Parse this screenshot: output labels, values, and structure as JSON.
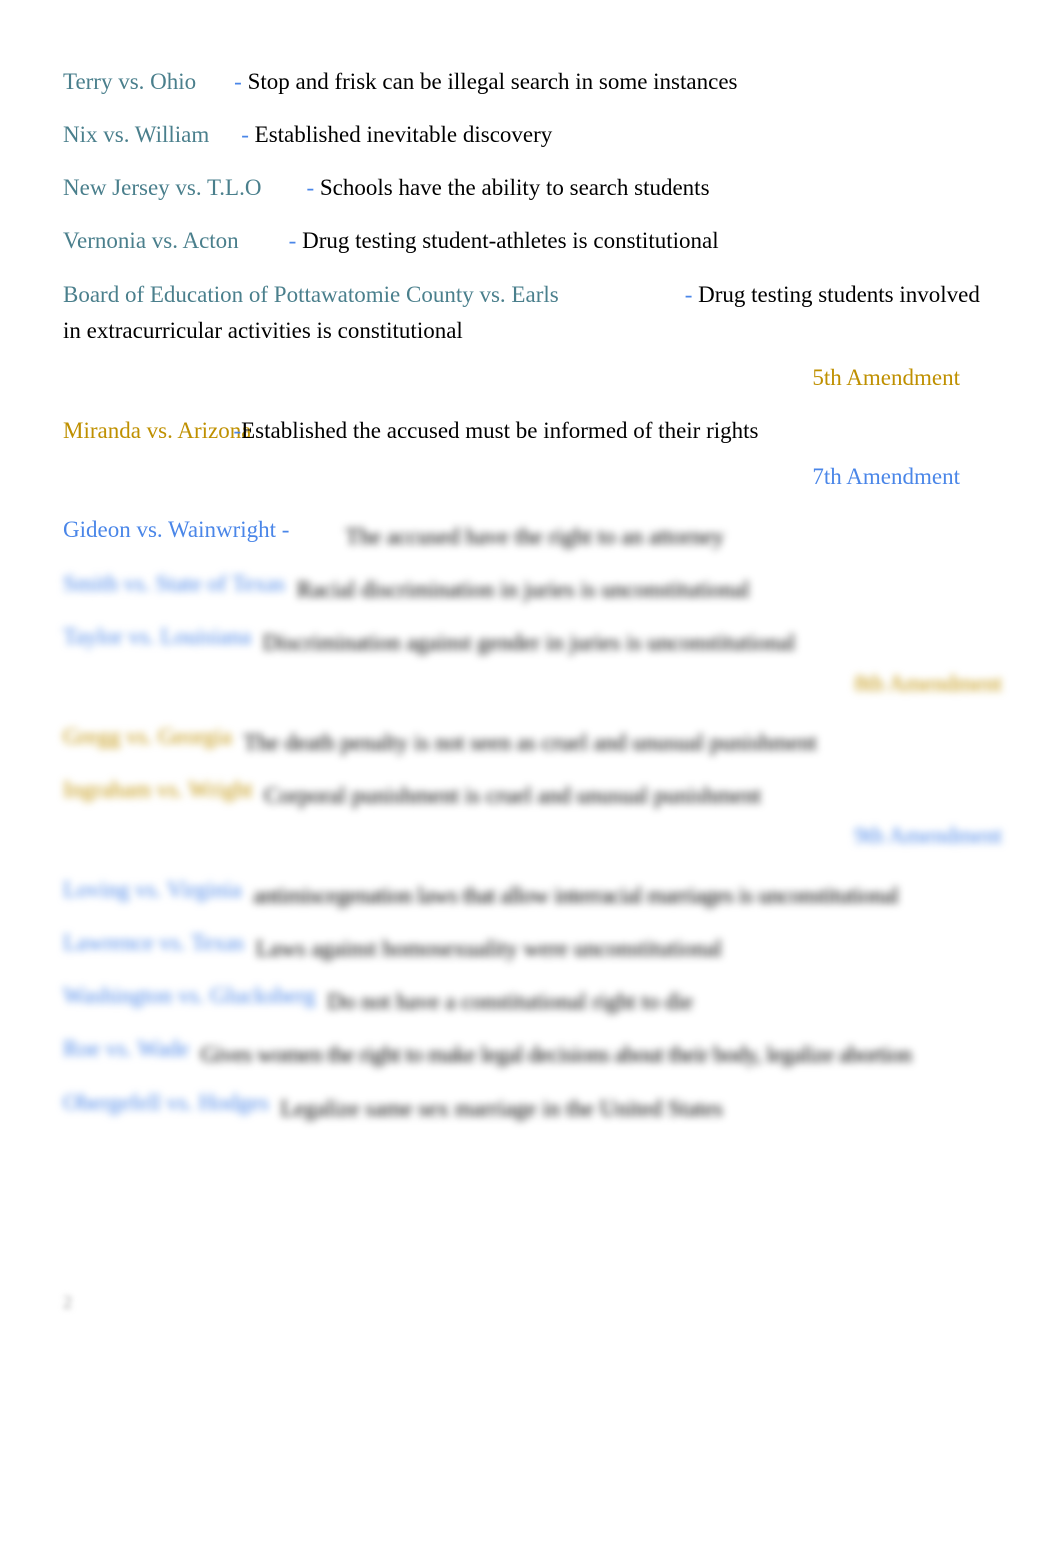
{
  "colors": {
    "fourth_case": "#4a7f8c",
    "seventh_case": "#4a86e8",
    "fifth_case": "#bf9000",
    "dash": "#4a86e8"
  },
  "cases_top": [
    {
      "name": "Terry vs. Ohio",
      "desc": "Stop and frisk can be illegal search in some instances"
    },
    {
      "name": "Nix vs. William",
      "desc": "Established inevitable discovery"
    },
    {
      "name": "New Jersey vs. T.L.O",
      "desc": "Schools have the ability to search students"
    },
    {
      "name": "Vernonia vs. Acton",
      "desc": "Drug testing student-athletes is constitutional"
    },
    {
      "name": "Board of Education of Pottawatomie County vs. Earls",
      "desc": "Drug testing students involved",
      "desc_cont": "in extracurricular activities is constitutional"
    }
  ],
  "dash": "-",
  "fifth": {
    "heading": "5th Amendment",
    "case": {
      "name": "Miranda vs. Arizona",
      "desc": "Established the accused must be informed of their rights"
    }
  },
  "seventh": {
    "heading": "7th Amendment",
    "cases": [
      {
        "name": "Gideon vs. Wainwright -",
        "desc": "The accused have the right to an attorney"
      },
      {
        "name": "Smith vs. State of Texas",
        "desc": "Racial discrimination in juries is unconstitutional"
      },
      {
        "name": "Taylor vs. Louisiana",
        "desc": "Discrimination against gender in juries is unconstitutional"
      }
    ]
  },
  "eighth": {
    "heading": "8th Amendment",
    "cases": [
      {
        "name": "Gregg vs. Georgia",
        "desc": "The death penalty is not seen as cruel and unusual punishment"
      },
      {
        "name": "Ingraham vs. Wright",
        "desc": "Corporal punishment is cruel and unusual punishment"
      }
    ]
  },
  "ninth": {
    "heading": "9th Amendment",
    "cases": [
      {
        "name": "Loving vs. Virginia",
        "desc": "antimiscegenation laws that allow interracial marriages is unconstitutional"
      },
      {
        "name": "Lawrence vs. Texas",
        "desc": "Laws against homosexuality were unconstitutional"
      },
      {
        "name": "Washington vs. Glucksberg",
        "desc": "Do not have a constitutional right to die"
      },
      {
        "name": "Roe vs. Wade",
        "desc": "Gives women the right to make legal decisions about their body, legalize abortion"
      },
      {
        "name": "Obergefell vs. Hodges",
        "desc": "Legalize same sex marriage in the United States"
      }
    ]
  },
  "page_number": "2"
}
